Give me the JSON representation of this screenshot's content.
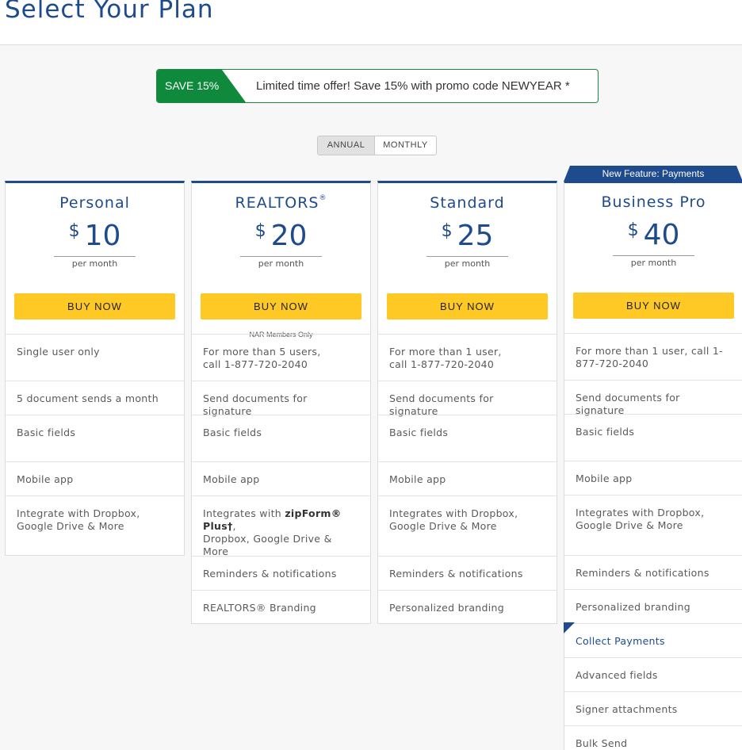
{
  "page": {
    "title": "Select Your Plan"
  },
  "promo": {
    "tag": "SAVE 15%",
    "text": "Limited time offer! Save 15% with promo code NEWYEAR *"
  },
  "billing_toggle": {
    "annual": "ANNUAL",
    "monthly": "MONTHLY",
    "selected": "ANNUAL"
  },
  "colors": {
    "brand_blue": "#1e4a8e",
    "buy_yellow": "#fec924",
    "promo_green": "#0f8a3c"
  },
  "plans": [
    {
      "name": "Personal",
      "currency": "$",
      "price": "10",
      "period": "per month",
      "cta": "BUY NOW",
      "features": [
        "Single user only",
        "5 document sends a month",
        "Basic fields",
        "Mobile app",
        "Integrate with Dropbox, Google Drive & More"
      ]
    },
    {
      "name": "REALTORS",
      "name_mark": "®",
      "currency": "$",
      "price": "20",
      "period": "per month",
      "cta": "BUY NOW",
      "note": "NAR Members Only",
      "features": [
        "For more than 5 users,",
        "call 1-877-720-2040",
        "Send documents for signature",
        "Basic fields",
        "Mobile app",
        "Integrates with",
        "zipForm® Plus†",
        ",",
        "Dropbox, Google Drive & More",
        "Reminders & notifications",
        "REALTORS® Branding"
      ]
    },
    {
      "name": "Standard",
      "currency": "$",
      "price": "25",
      "period": "per month",
      "cta": "BUY NOW",
      "features": [
        "For more than 1 user,",
        "call 1-877-720-2040",
        "Send documents for signature",
        "Basic fields",
        "Mobile app",
        "Integrates with Dropbox, Google Drive & More",
        "Reminders & notifications",
        "Personalized branding"
      ]
    },
    {
      "name": "Business Pro",
      "badge": "New Feature: Payments",
      "currency": "$",
      "price": "40",
      "period": "per month",
      "cta": "BUY NOW",
      "features": [
        "For more than 1 user, call 1-877-720-2040",
        "Send documents for signature",
        "Basic fields",
        "Mobile app",
        "Integrates with Dropbox, Google Drive & More",
        "Reminders & notifications",
        "Personalized branding",
        "Collect Payments",
        "Advanced fields",
        "Signer attachments",
        "Bulk Send"
      ]
    }
  ]
}
